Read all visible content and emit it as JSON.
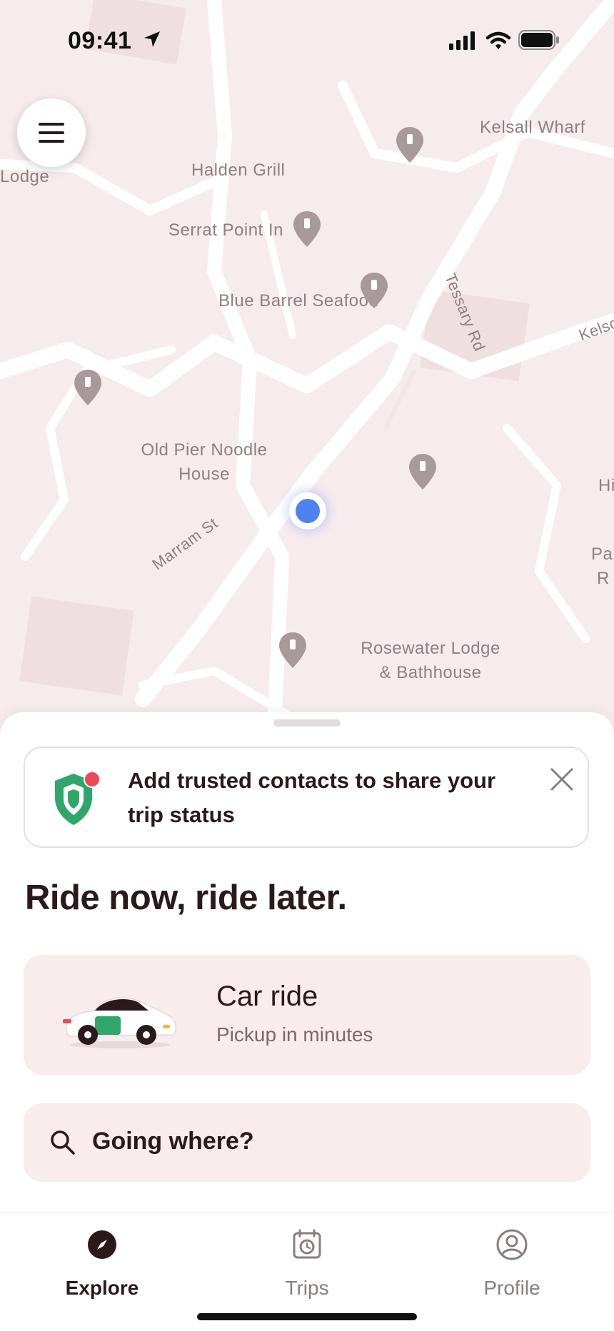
{
  "status_bar": {
    "time": "09:41",
    "icons": [
      "location-arrow-icon",
      "cellular-signal-icon",
      "wifi-icon",
      "battery-icon"
    ]
  },
  "map": {
    "labels": {
      "kelsall_wharf": "Kelsall Wharf",
      "lodge": "Lodge",
      "halden_grill": "Halden Grill",
      "serrat_point": "Serrat Point In",
      "blue_barrel": "Blue Barrel Seafood",
      "tessary_rd": "Tessary Rd",
      "kelso": "Kelso",
      "old_pier_1": "Old Pier Noodle",
      "old_pier_2": "House",
      "marram_st": "Marram St",
      "rosewater_1": "Rosewater Lodge",
      "rosewater_2": "& Bathhouse",
      "hi": "Hi",
      "pa": "Pa",
      "r": "R"
    }
  },
  "banner": {
    "text": "Add trusted contacts to share your trip status",
    "icon": "shield-icon",
    "close_icon": "close-icon"
  },
  "headline": "Ride now, ride later.",
  "car_card": {
    "title": "Car ride",
    "subtitle": "Pickup in minutes"
  },
  "search": {
    "label": "Going where?",
    "icon": "search-icon"
  },
  "tabs": [
    {
      "label": "Explore",
      "icon": "compass-icon",
      "active": true
    },
    {
      "label": "Trips",
      "icon": "calendar-clock-icon",
      "active": false
    },
    {
      "label": "Profile",
      "icon": "profile-icon",
      "active": false
    }
  ],
  "colors": {
    "map_bg": "#f7eced",
    "road": "#ffffff",
    "pin": "#a8999b",
    "user_dot": "#4f82f0",
    "shield": "#2fa76a",
    "card_bg": "#f9eced",
    "text_dark": "#2a1a1c"
  }
}
